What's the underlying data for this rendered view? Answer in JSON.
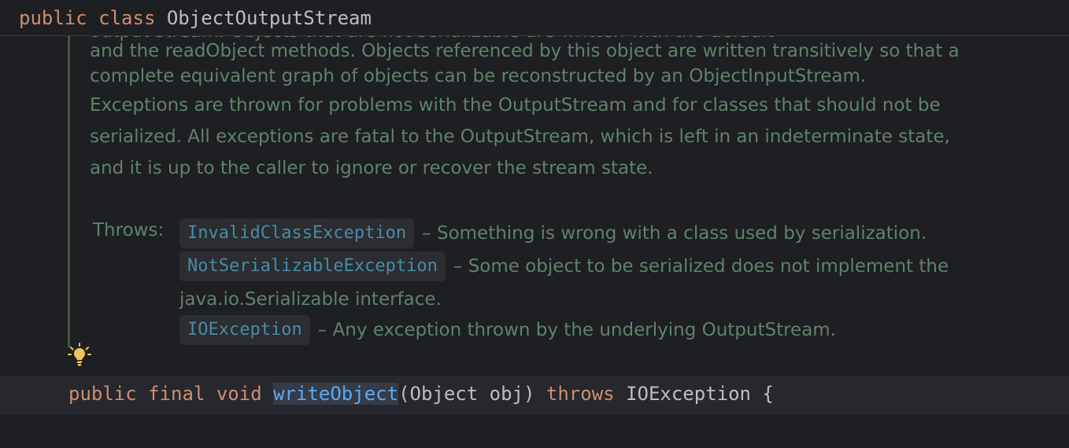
{
  "header": {
    "modifier": "public",
    "keyword": "class",
    "class_name": "ObjectOutputStream"
  },
  "doc": {
    "clipped_line": "output stream. Objects that are not serializable are written with the default",
    "lines_block": [
      "and the readObject methods. Objects referenced by this object are written transitively so that a",
      "complete equivalent graph of objects can be reconstructed by an ObjectInputStream."
    ],
    "lines_main": [
      "Exceptions are thrown for problems with the OutputStream and for classes that should not be",
      "serialized. All exceptions are fatal to the OutputStream, which is left in an indeterminate state,",
      "and it is up to the caller to ignore or recover the stream state."
    ],
    "throws_label": "Throws:",
    "throws": [
      {
        "exception": "InvalidClassException",
        "desc": "– Something is wrong with a class used by serialization."
      },
      {
        "exception": "NotSerializableException",
        "desc": "– Some object to be serialized does not implement the"
      },
      {
        "exception": "",
        "desc": "java.io.Serializable interface."
      },
      {
        "exception": "IOException",
        "desc": "– Any exception thrown by the underlying OutputStream."
      }
    ]
  },
  "code": {
    "kw1": "public",
    "kw2": "final",
    "kw3": "void",
    "method": "writeObject",
    "params": "(Object obj)",
    "throws_kw": "throws",
    "rest": "IOException {"
  },
  "colors": {
    "background": "#1e1f22",
    "doc_text": "#5f826b",
    "keyword": "#cf8e6d",
    "method": "#57aaf7",
    "exception_link": "#4a8aa8"
  },
  "icons": {
    "intention": "lightbulb-icon"
  }
}
